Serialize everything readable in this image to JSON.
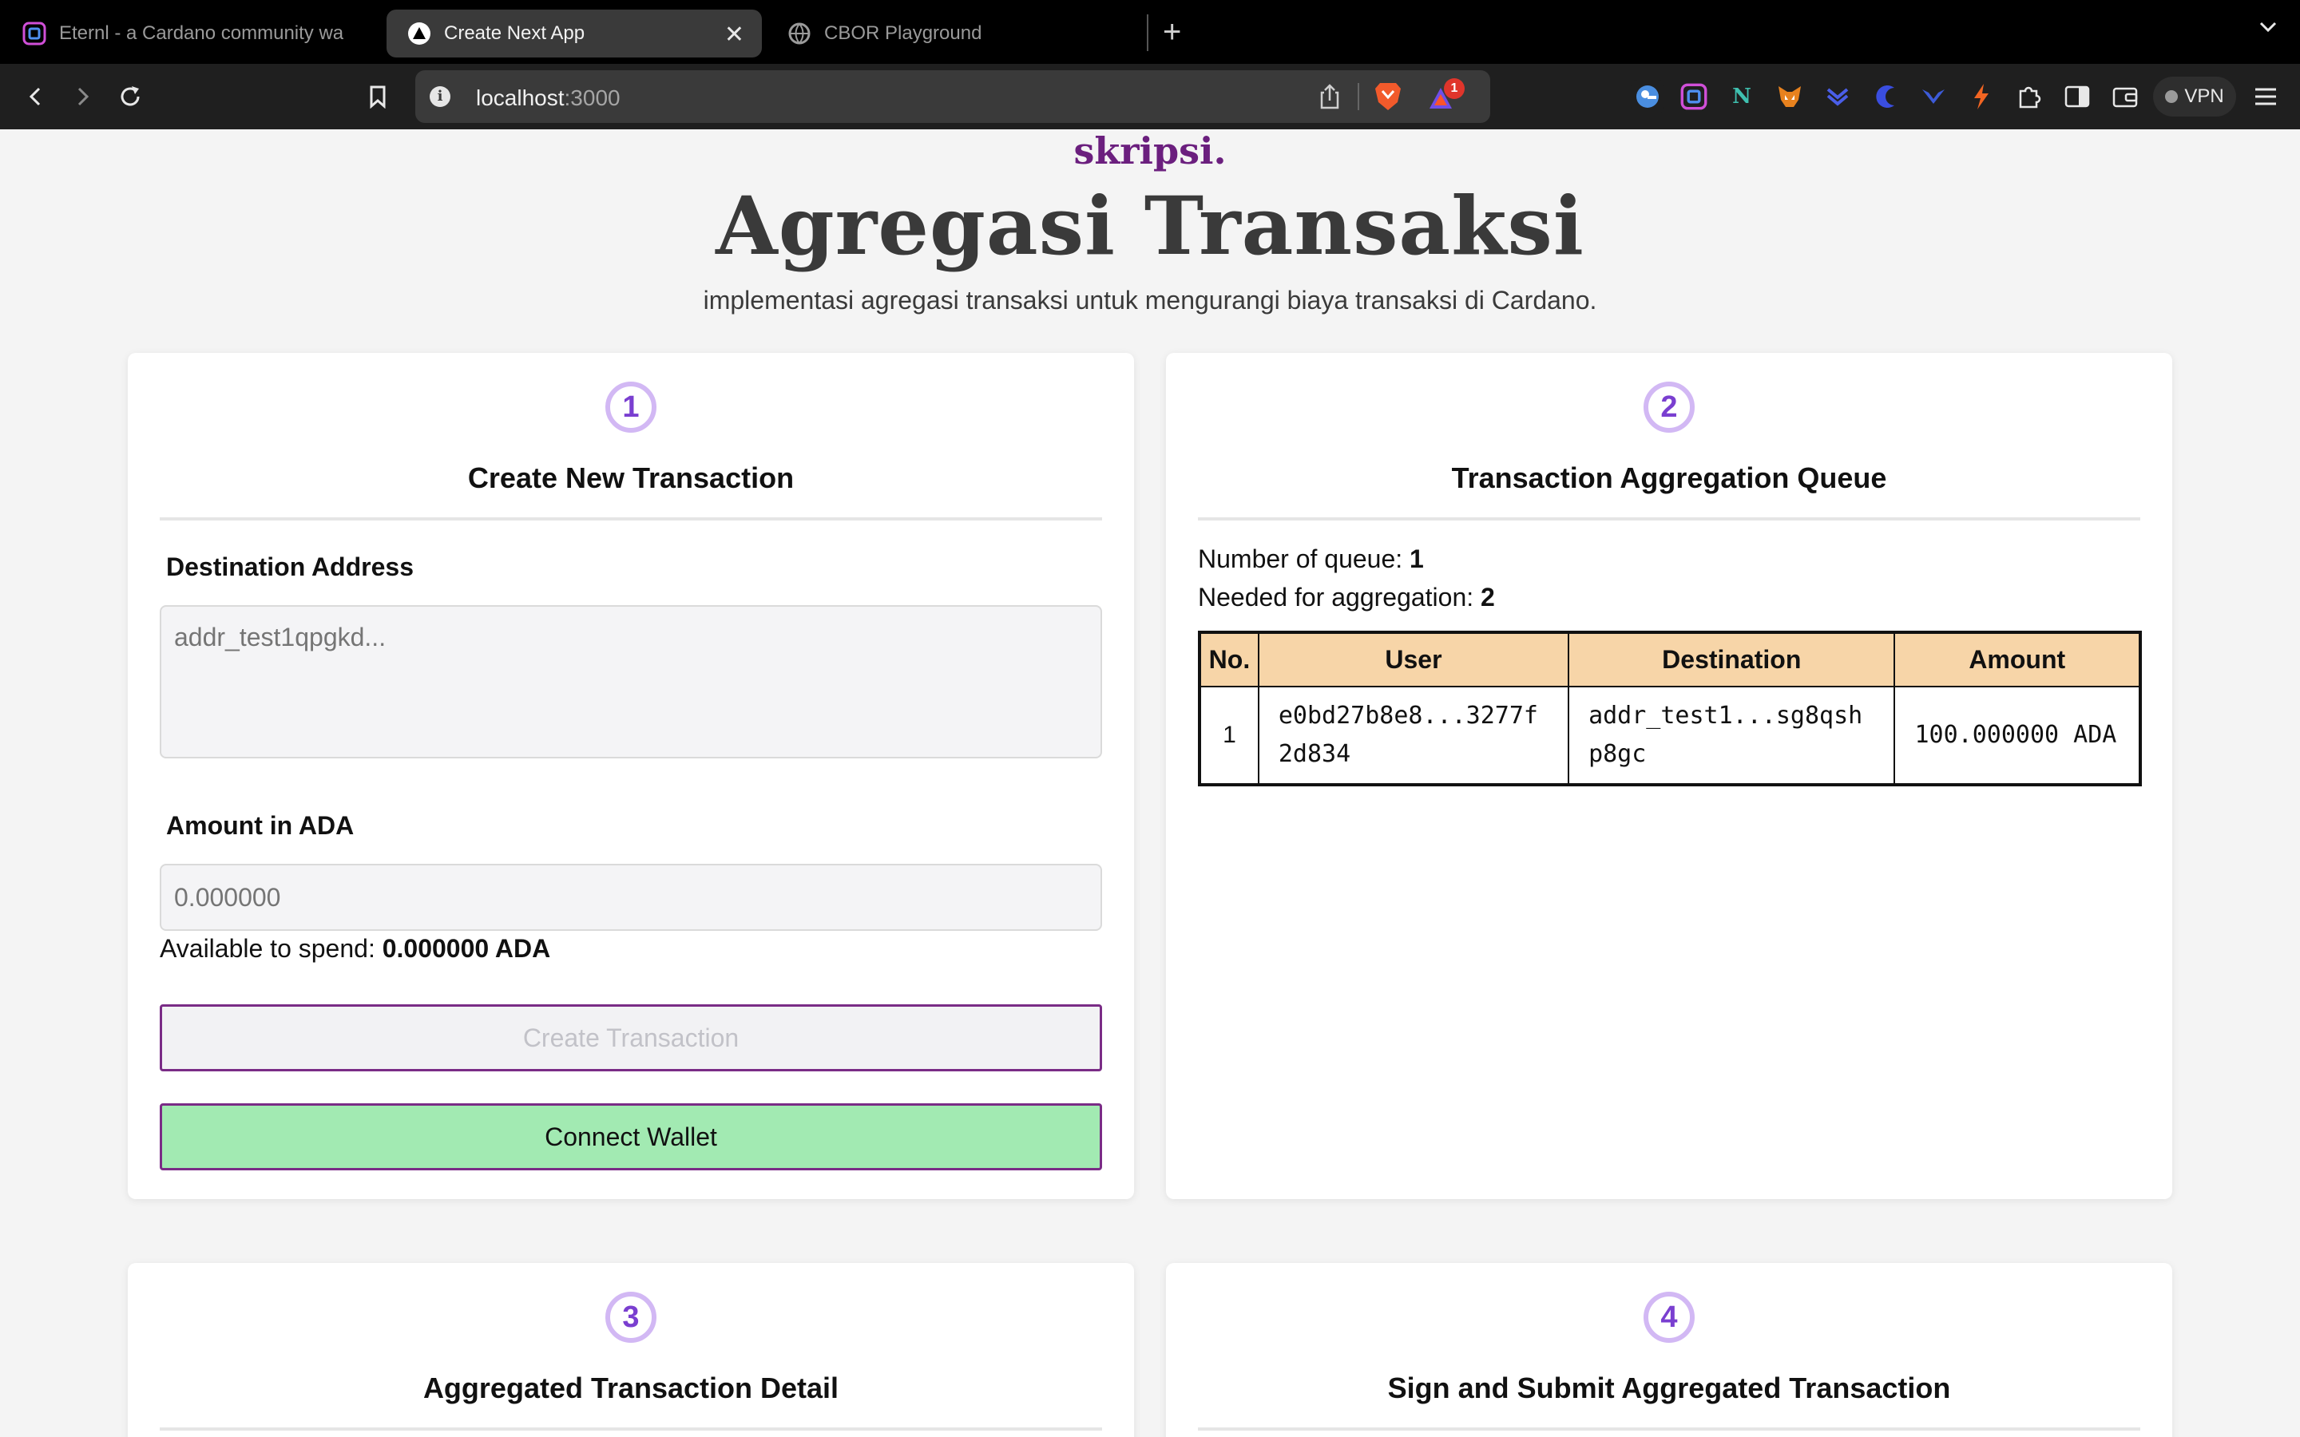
{
  "browser": {
    "tabs": [
      {
        "title": "Eternl - a Cardano community wa",
        "favicon": "eternl-icon",
        "active": false
      },
      {
        "title": "Create Next App",
        "favicon": "nextjs-triangle-icon",
        "active": true
      },
      {
        "title": "CBOR Playground",
        "favicon": "globe-icon",
        "active": false
      }
    ],
    "url_host": "localhost",
    "url_port": ":3000",
    "notification_count": "1",
    "vpn_label": "VPN"
  },
  "page": {
    "brand": "skripsi.",
    "title": "Agregasi Transaksi",
    "subtitle": "implementasi agregasi transaksi untuk mengurangi biaya transaksi di Cardano."
  },
  "cards": {
    "create": {
      "step": "1",
      "title": "Create New Transaction",
      "destination_label": "Destination Address",
      "destination_placeholder": "addr_test1qpgkd...",
      "amount_label": "Amount in ADA",
      "amount_placeholder": "0.000000",
      "available_label": "Available to spend: ",
      "available_value": "0.000000 ADA",
      "create_button": "Create Transaction",
      "connect_button": "Connect Wallet"
    },
    "queue": {
      "step": "2",
      "title": "Transaction Aggregation Queue",
      "count_label": "Number of queue: ",
      "count_value": "1",
      "needed_label": "Needed for aggregation: ",
      "needed_value": "2",
      "columns": [
        "No.",
        "User",
        "Destination",
        "Amount"
      ],
      "rows": [
        {
          "no": "1",
          "user": "e0bd27b8e8...3277f2d834",
          "destination": "addr_test1...sg8qshp8gc",
          "amount": "100.000000 ADA"
        }
      ]
    },
    "detail": {
      "step": "3",
      "title": "Aggregated Transaction Detail"
    },
    "submit": {
      "step": "4",
      "title": "Sign and Submit Aggregated Transaction"
    }
  },
  "colors": {
    "brand": "#6b1f7e",
    "step_ring": "#d2b8f4",
    "step_text": "#7a3fd0",
    "table_header": "#f7d5a8",
    "connect_button": "#a2eab2"
  }
}
